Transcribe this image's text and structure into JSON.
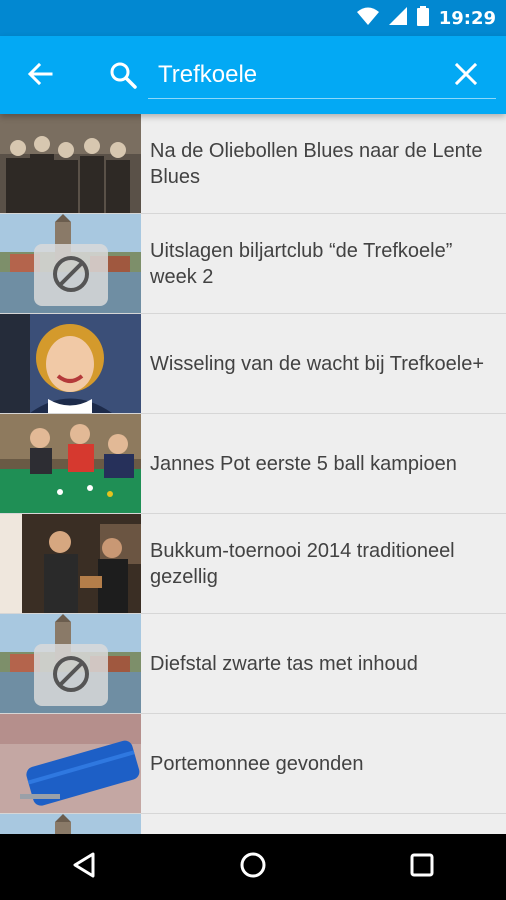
{
  "status_bar": {
    "time": "19:29",
    "icons": [
      "wifi-icon",
      "signal-icon",
      "battery-icon"
    ]
  },
  "app_bar": {
    "back_icon": "arrow-left-icon",
    "search_icon": "search-icon",
    "search_value": "Trefkoele",
    "clear_icon": "close-icon",
    "background": "#03a9f4",
    "status_background": "#0288d1"
  },
  "results": [
    {
      "title": "Na de Oliebollen Blues naar de Lente Blues",
      "thumbnail": "band-photo"
    },
    {
      "title": "Uitslagen biljartclub “de Trefkoele” week 2",
      "thumbnail": "placeholder-town"
    },
    {
      "title": "Wisseling van de wacht bij Trefkoele+",
      "thumbnail": "portrait-woman"
    },
    {
      "title": "Jannes Pot eerste 5 ball kampioen",
      "thumbnail": "billiards-photo"
    },
    {
      "title": "Bukkum-toernooi 2014 traditioneel gezellig",
      "thumbnail": "pub-photo"
    },
    {
      "title": "Diefstal zwarte tas met inhoud",
      "thumbnail": "placeholder-town"
    },
    {
      "title": "Portemonnee gevonden",
      "thumbnail": "wallet-photo"
    },
    {
      "title": "",
      "thumbnail": "placeholder-town"
    }
  ],
  "nav_bar": {
    "icons": [
      "back-triangle-icon",
      "home-circle-icon",
      "recents-square-icon"
    ]
  }
}
